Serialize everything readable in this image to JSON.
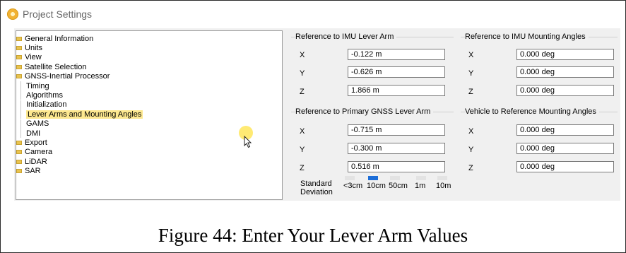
{
  "window": {
    "title": "Project Settings"
  },
  "tree": {
    "items": [
      {
        "label": "General Information",
        "type": "folder"
      },
      {
        "label": "Units",
        "type": "folder"
      },
      {
        "label": "View",
        "type": "folder"
      },
      {
        "label": "Satellite Selection",
        "type": "folder"
      },
      {
        "label": "GNSS-Inertial Processor",
        "type": "folder"
      },
      {
        "label": "Timing",
        "type": "child"
      },
      {
        "label": "Algorithms",
        "type": "child"
      },
      {
        "label": "Initialization",
        "type": "child"
      },
      {
        "label": "Lever Arms and Mounting Angles",
        "type": "child",
        "selected": true
      },
      {
        "label": "GAMS",
        "type": "child"
      },
      {
        "label": "DMI",
        "type": "child"
      },
      {
        "label": "Export",
        "type": "folder"
      },
      {
        "label": "Camera",
        "type": "folder"
      },
      {
        "label": "LiDAR",
        "type": "folder"
      },
      {
        "label": "SAR",
        "type": "folder"
      }
    ]
  },
  "imu_lever_arm": {
    "title": "Reference to IMU Lever Arm",
    "x_label": "X",
    "y_label": "Y",
    "z_label": "Z",
    "x": "-0.122 m",
    "y": "-0.626 m",
    "z": "1.866 m"
  },
  "imu_mounting": {
    "title": "Reference to IMU Mounting Angles",
    "x_label": "X",
    "y_label": "Y",
    "z_label": "Z",
    "x": "0.000 deg",
    "y": "0.000 deg",
    "z": "0.000 deg"
  },
  "gnss_lever_arm": {
    "title": "Reference to Primary GNSS Lever Arm",
    "x_label": "X",
    "y_label": "Y",
    "z_label": "Z",
    "x": "-0.715 m",
    "y": "-0.300 m",
    "z": "0.516 m"
  },
  "vehicle_mounting": {
    "title": "Vehicle to Reference Mounting Angles",
    "x_label": "X",
    "y_label": "Y",
    "z_label": "Z",
    "x": "0.000 deg",
    "y": "0.000 deg",
    "z": "0.000 deg"
  },
  "std_dev": {
    "label_line1": "Standard",
    "label_line2": "Deviation",
    "options": [
      "<3cm",
      "10cm",
      "50cm",
      "1m",
      "10m"
    ],
    "selected": "10cm"
  },
  "caption": "Figure 44: Enter Your Lever Arm Values"
}
